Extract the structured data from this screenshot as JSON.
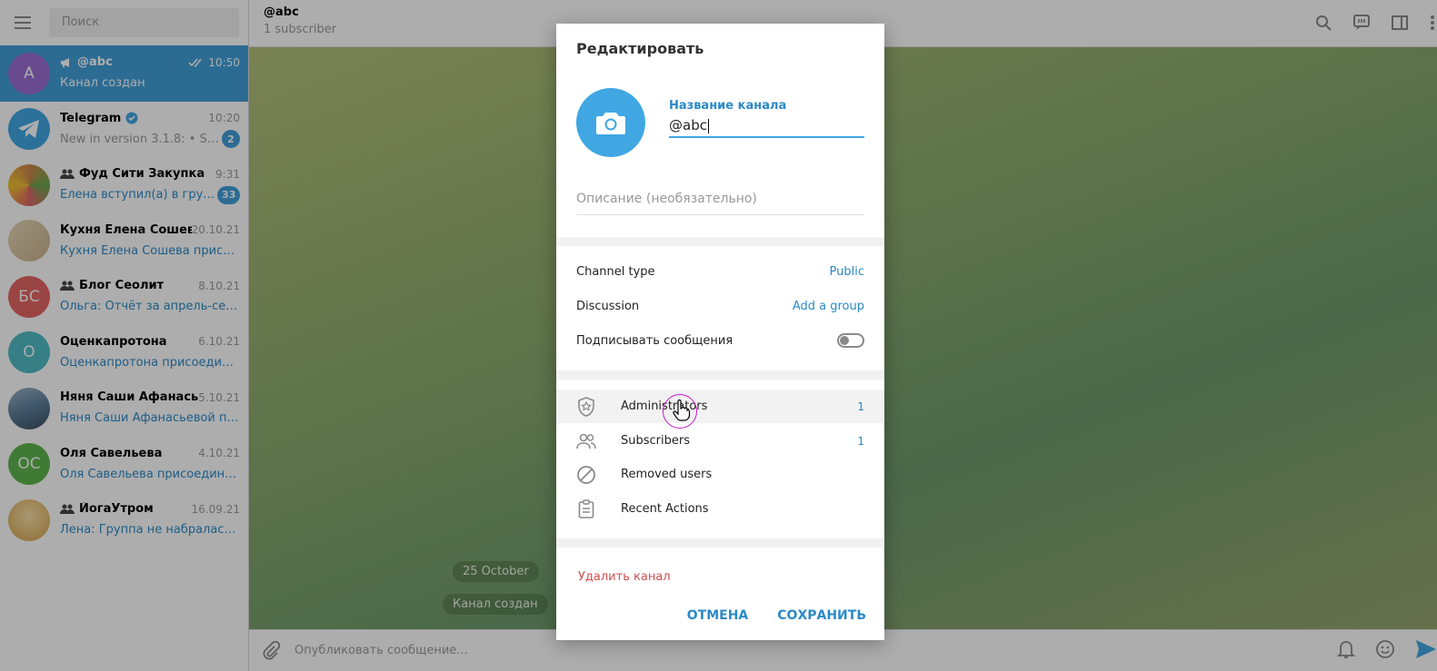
{
  "sidebar": {
    "search_placeholder": "Поиск",
    "chats": [
      {
        "initials": "A",
        "color": "#9b6ed3",
        "name": "@abc",
        "time": "10:50",
        "message": "Канал создан",
        "active": true
      },
      {
        "initials": "",
        "color": "#40a7e3",
        "name": "Telegram",
        "time": "10:20",
        "message": "New in version 3.1.8: • Smal...",
        "badge": "2"
      },
      {
        "initials": "",
        "color": "#d0874a",
        "name": "Фуд Сити Закупка",
        "time": "9:31",
        "message": "Елена вступил(а) в группу",
        "badge": "33"
      },
      {
        "initials": "",
        "color": "#c9b48d",
        "name": "Кухня Елена Сошева",
        "time": "20.10.21",
        "message": "Кухня Елена Сошева присоед..."
      },
      {
        "initials": "БС",
        "color": "#e56565",
        "name": "Блог Сеолит",
        "time": "8.10.21",
        "message": "Ольга: Отчёт за апрель-сентя..."
      },
      {
        "initials": "О",
        "color": "#4fbcc5",
        "name": "Оценкапротона",
        "time": "6.10.21",
        "message": "Оценкапротона присоединил..."
      },
      {
        "initials": "",
        "color": "#5d7f9a",
        "name": "Няня Саши Афанасье...",
        "time": "5.10.21",
        "message": "Няня Саши Афанасьевой прис..."
      },
      {
        "initials": "ОС",
        "color": "#5fb54e",
        "name": "Оля Савельева",
        "time": "4.10.21",
        "message": "Оля Савельева присоединилс..."
      },
      {
        "initials": "",
        "color": "#e8c27a",
        "name": "ЙогаУтром",
        "time": "16.09.21",
        "message": "Лена: Группа не набралась. Ут..."
      }
    ]
  },
  "header": {
    "title": "@abc",
    "subtitle": "1 subscriber"
  },
  "chat": {
    "date_pill": "25 October",
    "service_pill": "Канал создан",
    "composer_placeholder": "Опубликовать сообщение..."
  },
  "modal": {
    "title": "Редактировать",
    "name_label": "Название канала",
    "name_value": "@abc",
    "description_placeholder": "Описание (необязательно)",
    "channel_type_label": "Channel type",
    "channel_type_value": "Public",
    "discussion_label": "Discussion",
    "discussion_value": "Add a group",
    "sign_label": "Подписывать сообщения",
    "administrators_label": "Administrators",
    "administrators_count": "1",
    "subscribers_label": "Subscribers",
    "subscribers_count": "1",
    "removed_label": "Removed users",
    "recent_label": "Recent Actions",
    "delete_label": "Удалить канал",
    "cancel_label": "ОТМЕНА",
    "save_label": "СОХРАНИТЬ"
  },
  "colors": {
    "accent": "#40a7e3",
    "link": "#2b8ac6",
    "danger": "#d14e4e"
  }
}
